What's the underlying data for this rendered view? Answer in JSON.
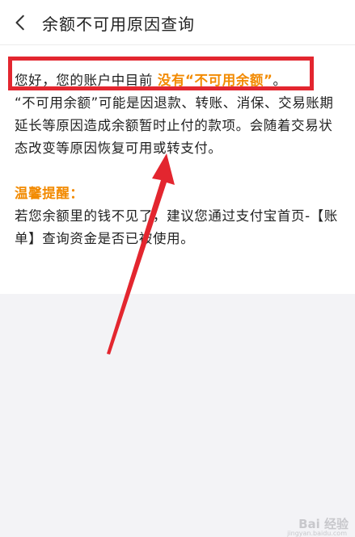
{
  "nav": {
    "title": "余额不可用原因查询",
    "back_icon": "chevron-left-icon"
  },
  "message": {
    "greeting_prefix": "您好，您的账户中目前 ",
    "greeting_highlight": "没有“不可用余额”",
    "greeting_suffix": "。",
    "paragraph": "“不可用余额”可能是因退款、转账、消保、交易账期延长等原因造成余额暂时止付的款项。会随着交易状态改变等原因恢复可用或转支付。",
    "tip_title": "温馨提醒：",
    "tip_body": "若您余额里的钱不见了，建议您通过支付宝首页-【账单】查询资金是否已被使用。"
  },
  "annotation": {
    "box_color": "#e3262f",
    "arrow_color": "#e3262f"
  },
  "watermark": {
    "text": "Bai 经验",
    "url": "jingyan.baidu.com"
  },
  "colors": {
    "accent": "#f28a00",
    "background": "#f3f3f6"
  }
}
